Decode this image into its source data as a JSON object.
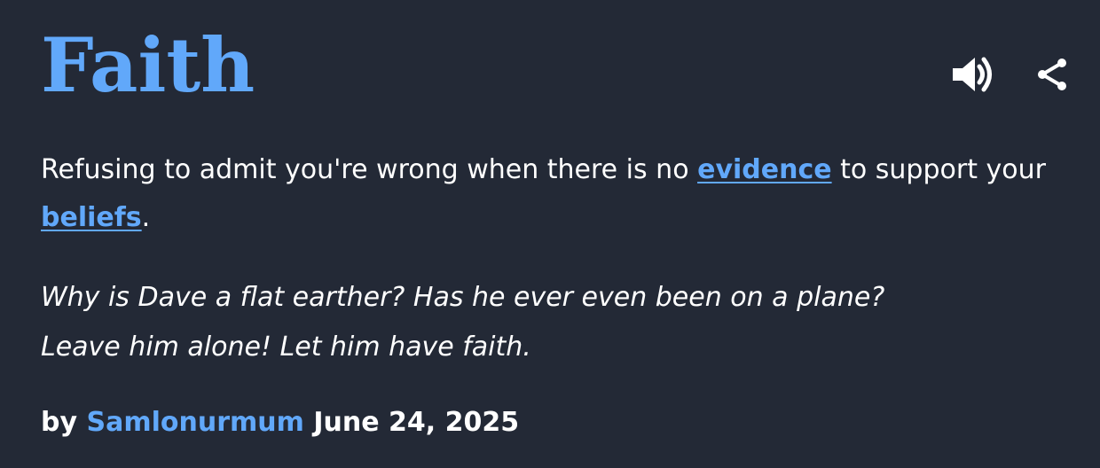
{
  "entry": {
    "word": "Faith",
    "definition": {
      "part1": "Refusing to admit you're wrong when there is no ",
      "link1": "evidence",
      "part2": " to support your ",
      "link2": "beliefs",
      "part3": "."
    },
    "example_lines": [
      "Why is Dave a flat earther? Has he ever even been on a plane?",
      "Leave him alone! Let him have faith."
    ],
    "contributor": {
      "by_label": "by",
      "author": "Samlonurmum",
      "date": "June 24, 2025"
    }
  },
  "icons": {
    "audio": "speaker-volume-icon",
    "share": "share-icon"
  },
  "colors": {
    "background": "#232936",
    "accent": "#61a8fa",
    "text": "#ffffff"
  }
}
